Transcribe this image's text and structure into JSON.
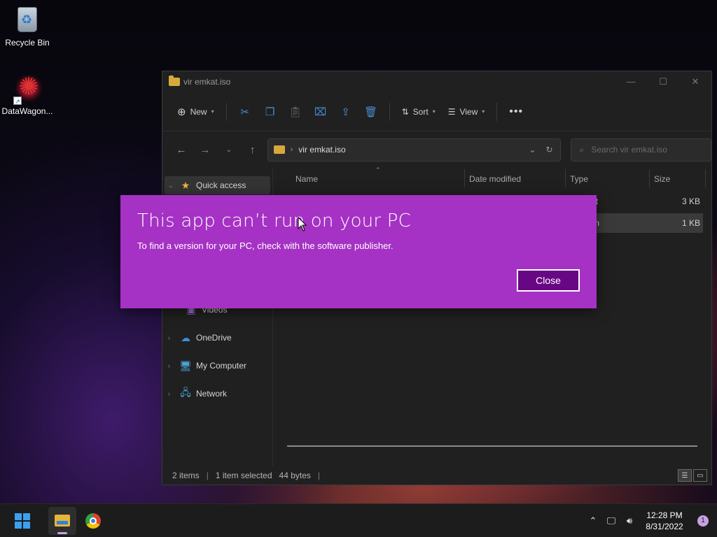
{
  "desktop": {
    "icons": [
      {
        "label": "Recycle Bin",
        "icon": "recycle-bin-icon"
      },
      {
        "label": "DataWagon...",
        "icon": "datawagon-app-icon"
      }
    ]
  },
  "explorer": {
    "title": "vir emkat.iso",
    "window_controls": [
      "minimize",
      "maximize",
      "close"
    ],
    "toolbar": {
      "new_label": "New",
      "sort_label": "Sort",
      "view_label": "View",
      "icons": [
        "cut-icon",
        "copy-icon",
        "paste-icon",
        "rename-icon",
        "share-icon",
        "delete-icon"
      ]
    },
    "address": {
      "path": "vir emkat.iso",
      "search_placeholder": "Search vir emkat.iso"
    },
    "nav": {
      "quick_access": "Quick access",
      "videos": "Videos",
      "onedrive": "OneDrive",
      "my_computer": "My Computer",
      "network": "Network"
    },
    "columns": {
      "name": "Name",
      "date_modified": "Date modified",
      "type": "Type",
      "size": "Size"
    },
    "files": [
      {
        "type_partial": "ut",
        "size": "3 KB",
        "selected": false
      },
      {
        "type_partial": "ation",
        "size": "1 KB",
        "selected": true
      }
    ],
    "status": {
      "items": "2 items",
      "selection": "1 item selected",
      "bytes": "44 bytes"
    }
  },
  "dialog": {
    "title": "This app can’t run on your PC",
    "message": "To find a version for your PC, check with the software publisher.",
    "close_label": "Close",
    "bg_color": "#a532c4",
    "button_color": "#680783"
  },
  "taskbar": {
    "apps": [
      "start-button",
      "file-explorer",
      "chrome"
    ],
    "time": "12:28 PM",
    "date": "8/31/2022",
    "notification_count": "1"
  }
}
